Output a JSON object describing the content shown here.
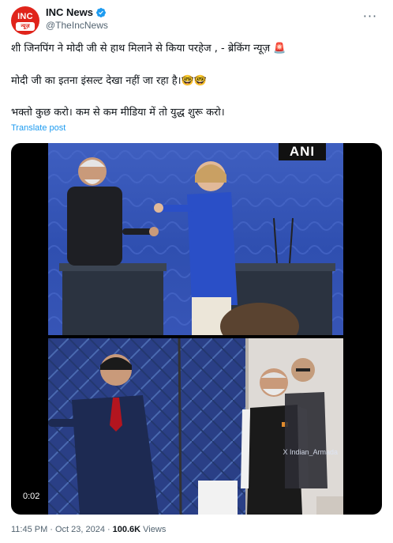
{
  "author": {
    "avatar_text_top": "INC",
    "avatar_text_bottom": "न्यूज़",
    "display_name": "INC News",
    "handle": "@TheIncNews",
    "verified": true
  },
  "more_menu": {
    "icon": "more-horizontal-icon",
    "label": "···"
  },
  "tweet": {
    "line1": "शी जिनपिंग ने मोदी जी से हाथ मिलाने से किया परहेज , - ब्रेकिंग न्यूज़ 🚨",
    "line2": "मोदी जी का इतना इंसल्ट देखा नहीं जा रहा है।🤓🤓",
    "line3": "भक्तो कुछ करो।  कम से कम मीडिया में तो युद्ध शुरू करो।",
    "translate_label": "Translate post"
  },
  "video": {
    "top_watermark": "ANI",
    "bottom_watermark": "X Indian_Armada",
    "timer": "0:02"
  },
  "meta": {
    "time": "11:45 PM",
    "separator": "·",
    "date": "Oct 23, 2024",
    "views_count": "100.6K",
    "views_label": "Views"
  },
  "colors": {
    "accent": "#1d9bf0",
    "text": "#0f1419",
    "muted": "#536471",
    "brand_red": "#e0241b"
  }
}
